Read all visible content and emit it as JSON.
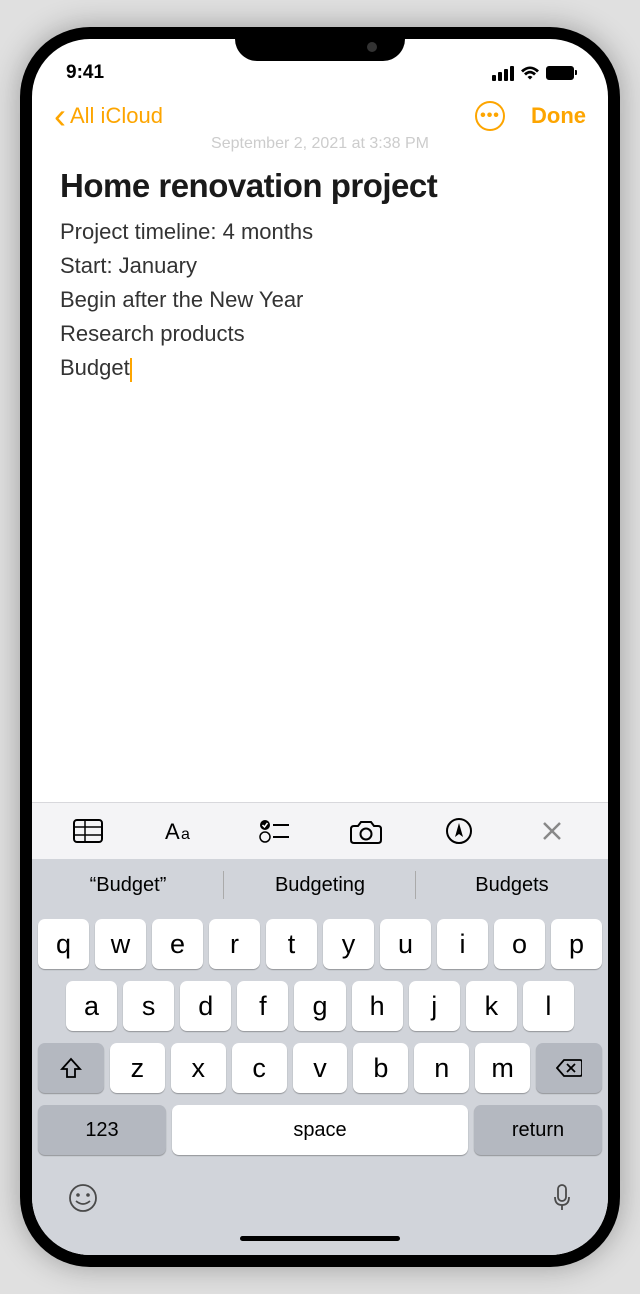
{
  "status": {
    "time": "9:41"
  },
  "nav": {
    "back": "All iCloud",
    "done": "Done"
  },
  "timestamp": "September 2, 2021 at 3:38 PM",
  "note": {
    "title": "Home renovation project",
    "lines": [
      "Project timeline: 4 months",
      "Start: January",
      "Begin after the New Year",
      "Research products",
      "Budget"
    ]
  },
  "suggestions": [
    "“Budget”",
    "Budgeting",
    "Budgets"
  ],
  "keyboard": {
    "row1": [
      "q",
      "w",
      "e",
      "r",
      "t",
      "y",
      "u",
      "i",
      "o",
      "p"
    ],
    "row2": [
      "a",
      "s",
      "d",
      "f",
      "g",
      "h",
      "j",
      "k",
      "l"
    ],
    "row3": [
      "z",
      "x",
      "c",
      "v",
      "b",
      "n",
      "m"
    ],
    "numKey": "123",
    "space": "space",
    "return": "return"
  }
}
